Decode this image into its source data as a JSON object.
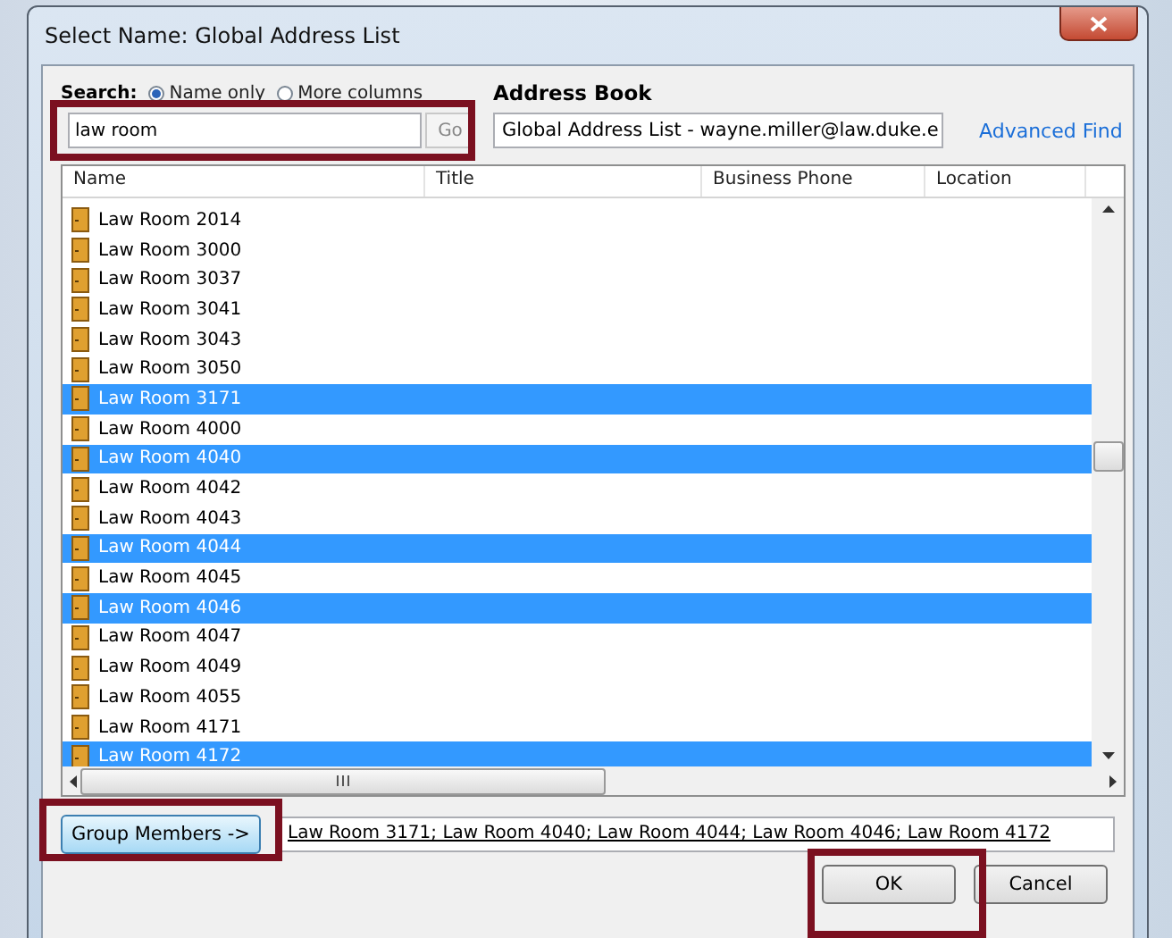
{
  "window": {
    "title": "Select Name: Global Address List"
  },
  "search": {
    "label": "Search:",
    "options": [
      {
        "label": "Name only",
        "selected": true
      },
      {
        "label": "More columns",
        "selected": false
      }
    ],
    "value": "law room",
    "go": "Go"
  },
  "address_book": {
    "label": "Address Book",
    "value": "Global Address List - wayne.miller@law.duke.e",
    "advanced": "Advanced Find"
  },
  "table": {
    "columns": [
      "Name",
      "Title",
      "Business Phone",
      "Location"
    ],
    "rows": [
      {
        "name": "Law Room 2014",
        "selected": false
      },
      {
        "name": "Law Room 3000",
        "selected": false
      },
      {
        "name": "Law Room 3037",
        "selected": false
      },
      {
        "name": "Law Room 3041",
        "selected": false
      },
      {
        "name": "Law Room 3043",
        "selected": false
      },
      {
        "name": "Law Room 3050",
        "selected": false
      },
      {
        "name": "Law Room 3171",
        "selected": true
      },
      {
        "name": "Law Room 4000",
        "selected": false
      },
      {
        "name": "Law Room 4040",
        "selected": true
      },
      {
        "name": "Law Room 4042",
        "selected": false
      },
      {
        "name": "Law Room 4043",
        "selected": false
      },
      {
        "name": "Law Room 4044",
        "selected": true
      },
      {
        "name": "Law Room 4045",
        "selected": false
      },
      {
        "name": "Law Room 4046",
        "selected": true
      },
      {
        "name": "Law Room 4047",
        "selected": false
      },
      {
        "name": "Law Room 4049",
        "selected": false
      },
      {
        "name": "Law Room 4055",
        "selected": false
      },
      {
        "name": "Law Room 4171",
        "selected": false
      },
      {
        "name": "Law Room 4172",
        "selected": true
      }
    ]
  },
  "group_members": {
    "button": "Group Members ->",
    "value": "Law Room 3171; Law Room 4040; Law Room 4044; Law Room 4046; Law Room 4172"
  },
  "buttons": [
    "OK",
    "Cancel"
  ]
}
